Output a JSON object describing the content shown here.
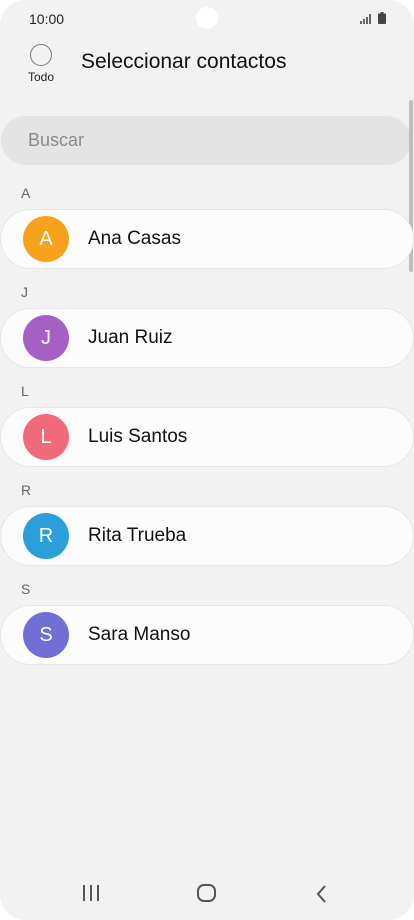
{
  "status_bar": {
    "time": "10:00",
    "icons": [
      "signal-icon",
      "battery-icon"
    ]
  },
  "header": {
    "select_all_label": "Todo",
    "title": "Seleccionar contactos"
  },
  "search": {
    "placeholder": "Buscar"
  },
  "contacts": {
    "sections": [
      {
        "letter": "A",
        "name": "Ana Casas",
        "initial": "A",
        "avatar_color": "#f7a21d"
      },
      {
        "letter": "J",
        "name": "Juan Ruiz",
        "initial": "J",
        "avatar_color": "#a65fc4"
      },
      {
        "letter": "L",
        "name": "Luis Santos",
        "initial": "L",
        "avatar_color": "#f06a7a"
      },
      {
        "letter": "R",
        "name": "Rita Trueba",
        "initial": "R",
        "avatar_color": "#2a9fd8"
      },
      {
        "letter": "S",
        "name": "Sara Manso",
        "initial": "S",
        "avatar_color": "#6f6fd6"
      }
    ]
  },
  "nav_bar": {
    "icons": [
      "recents-icon",
      "home-icon",
      "back-icon"
    ]
  }
}
